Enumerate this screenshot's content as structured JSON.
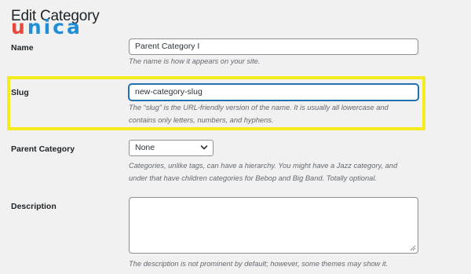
{
  "page": {
    "title": "Edit Category",
    "logo": {
      "first": "u",
      "rest": "nica"
    }
  },
  "form": {
    "name": {
      "label": "Name",
      "value": "Parent Category I",
      "hint": "The name is how it appears on your site."
    },
    "slug": {
      "label": "Slug",
      "value": "new-category-slug",
      "hint_line1": "The “slug” is the URL-friendly version of the name. It is usually all lowercase and",
      "hint_line2": "contains only letters, numbers, and hyphens."
    },
    "parent": {
      "label": "Parent Category",
      "selected": "None",
      "hint_line1": "Categories, unlike tags, can have a hierarchy. You might have a Jazz category, and",
      "hint_line2": "under that have children categories for Bebop and Big Band. Totally optional."
    },
    "description": {
      "label": "Description",
      "value": "",
      "hint": "The description is not prominent by default; however, some themes may show it."
    }
  },
  "colors": {
    "highlight": "#f5ec1f",
    "logo_red": "#e8483b",
    "logo_blue": "#1f8ed6",
    "focus": "#2271b1"
  },
  "icons": {
    "select_arrow": "chevron-down-icon",
    "resize": "resize-handle-icon"
  }
}
